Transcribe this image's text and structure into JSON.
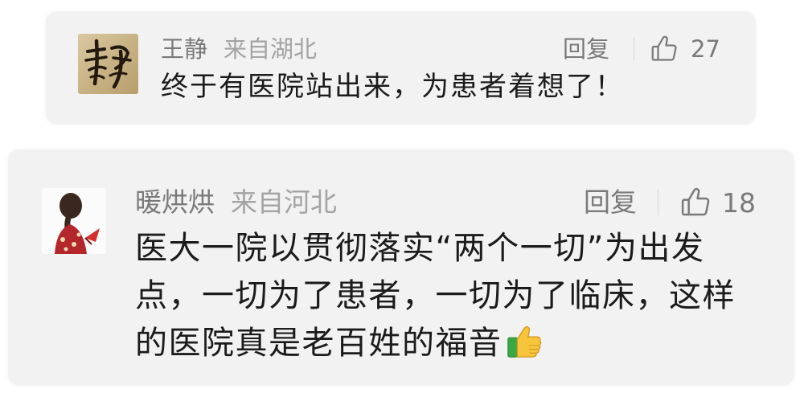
{
  "comments": [
    {
      "author": "王静",
      "location": "来自湖北",
      "reply_label": "回复",
      "likes": "27",
      "text": "终于有医院站出来，为患者着想了！",
      "avatar_icon": "calligraphy-avatar"
    },
    {
      "author": "暖烘烘",
      "location": "来自河北",
      "reply_label": "回复",
      "likes": "18",
      "text_lines": [
        "医大一院以贯彻落实“两个一切”为出发",
        "点，一切为了患者，一切为了临床，这样",
        "的医院真是老百姓的福音"
      ],
      "trailing_emoji_icon": "thumbs-up-emoji-icon",
      "avatar_icon": "girl-red-dress-avatar"
    }
  ],
  "icons": {
    "like": "thumbs-up-outline-icon"
  },
  "colors": {
    "card_background": "#f2f2f2",
    "meta_text": "#7a7a7a",
    "location_text": "#a3a3a3",
    "body_text": "#1b1b1b"
  }
}
